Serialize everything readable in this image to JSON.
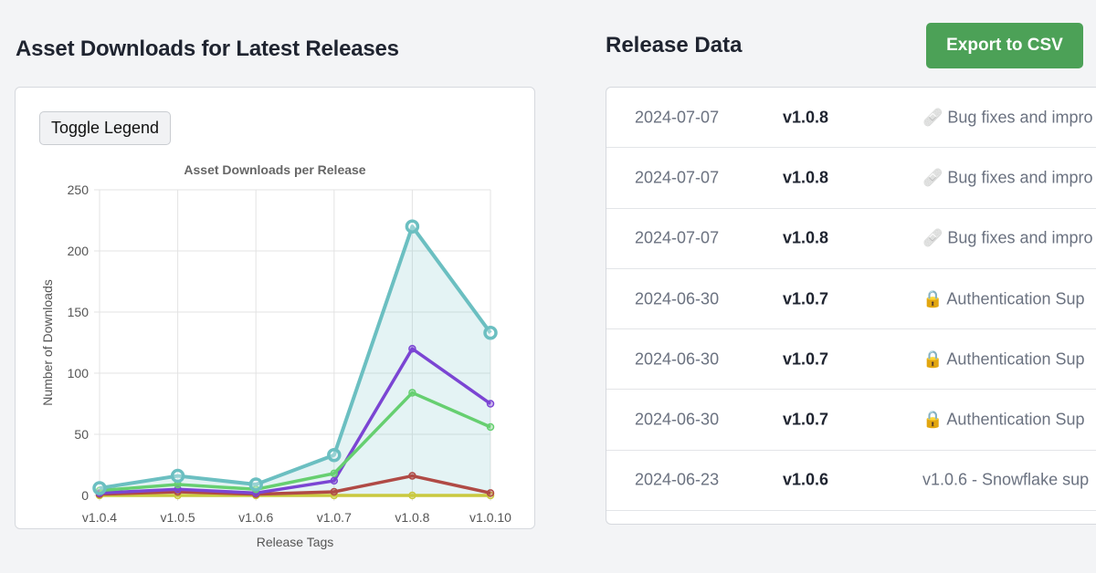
{
  "left": {
    "title": "Asset Downloads for Latest Releases"
  },
  "toggle_legend_label": "Toggle Legend",
  "chart_data": {
    "type": "line",
    "title": "Asset Downloads per Release",
    "xlabel": "Release Tags",
    "ylabel": "Number of Downloads",
    "categories": [
      "v1.0.4",
      "v1.0.5",
      "v1.0.6",
      "v1.0.7",
      "v1.0.8",
      "v1.0.10"
    ],
    "ylim": [
      0,
      250
    ],
    "yticks": [
      0,
      50,
      100,
      150,
      200,
      250
    ],
    "grid": true,
    "series": [
      {
        "values": [
          6,
          16,
          9,
          33,
          220,
          133
        ],
        "color": "#6bbfc1",
        "fill": true,
        "marker": "large"
      },
      {
        "values": [
          4,
          9,
          5,
          18,
          84,
          56
        ],
        "color": "#66cf70"
      },
      {
        "values": [
          2,
          5,
          2,
          12,
          120,
          75
        ],
        "color": "#7b45d3"
      },
      {
        "values": [
          1,
          3,
          1,
          3,
          16,
          2
        ],
        "color": "#b04a45"
      },
      {
        "values": [
          0,
          0,
          0,
          0,
          0,
          0
        ],
        "color": "#c9c93f"
      }
    ]
  },
  "right": {
    "title": "Release Data",
    "export_label": "Export to CSV"
  },
  "rows": [
    {
      "date": "2024-07-07",
      "version": "v1.0.8",
      "name": "🩹 Bug fixes and impro"
    },
    {
      "date": "2024-07-07",
      "version": "v1.0.8",
      "name": "🩹 Bug fixes and impro"
    },
    {
      "date": "2024-07-07",
      "version": "v1.0.8",
      "name": "🩹 Bug fixes and impro"
    },
    {
      "date": "2024-06-30",
      "version": "v1.0.7",
      "name": "🔒 Authentication Sup"
    },
    {
      "date": "2024-06-30",
      "version": "v1.0.7",
      "name": "🔒 Authentication Sup"
    },
    {
      "date": "2024-06-30",
      "version": "v1.0.7",
      "name": "🔒 Authentication Sup"
    },
    {
      "date": "2024-06-23",
      "version": "v1.0.6",
      "name": "v1.0.6 - Snowflake sup"
    }
  ]
}
